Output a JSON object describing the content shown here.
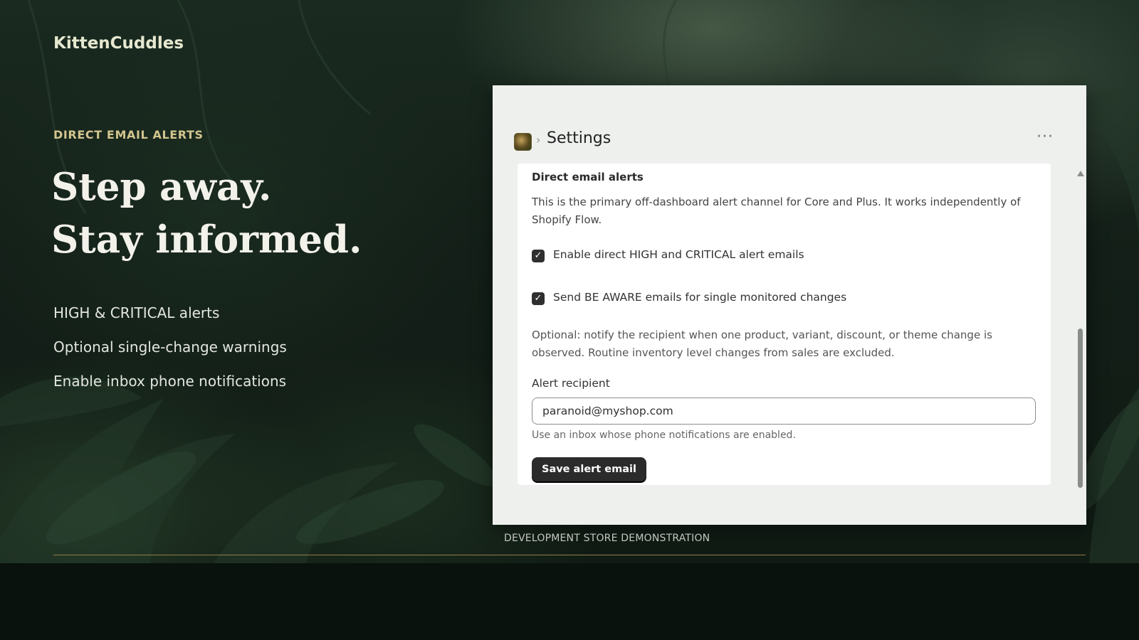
{
  "brand": {
    "name": "KittenCuddles"
  },
  "hero": {
    "eyebrow": "DIRECT EMAIL ALERTS",
    "headline": [
      "Step away.",
      "Stay informed."
    ],
    "features": [
      "HIGH & CRITICAL alerts",
      "Optional single-change warnings",
      "Enable inbox phone notifications"
    ]
  },
  "app": {
    "breadcrumb_separator": "›",
    "page_title": "Settings",
    "more_icon": "···",
    "card": {
      "title": "Direct email alerts",
      "description": "This is the primary off-dashboard alert channel for Core and Plus. It works independently of Shopify Flow.",
      "checkboxes": [
        {
          "label": "Enable direct HIGH and CRITICAL alert emails",
          "checked": true
        },
        {
          "label": "Send BE AWARE emails for single monitored changes",
          "checked": true
        }
      ],
      "optional_help": "Optional: notify the recipient when one product, variant, discount, or theme change is observed. Routine inventory level changes from sales are excluded.",
      "recipient_label": "Alert recipient",
      "recipient_value": "paranoid@myshop.com",
      "recipient_hint": "Use an inbox whose phone notifications are enabled.",
      "save_label": "Save alert email"
    },
    "check_glyph": "✓"
  },
  "footer": {
    "caption": "DEVELOPMENT STORE DEMONSTRATION"
  },
  "colors": {
    "accent_gold": "#d2c48e",
    "rule_gold": "#8f7f45",
    "button_dark": "#2b2b2b"
  }
}
